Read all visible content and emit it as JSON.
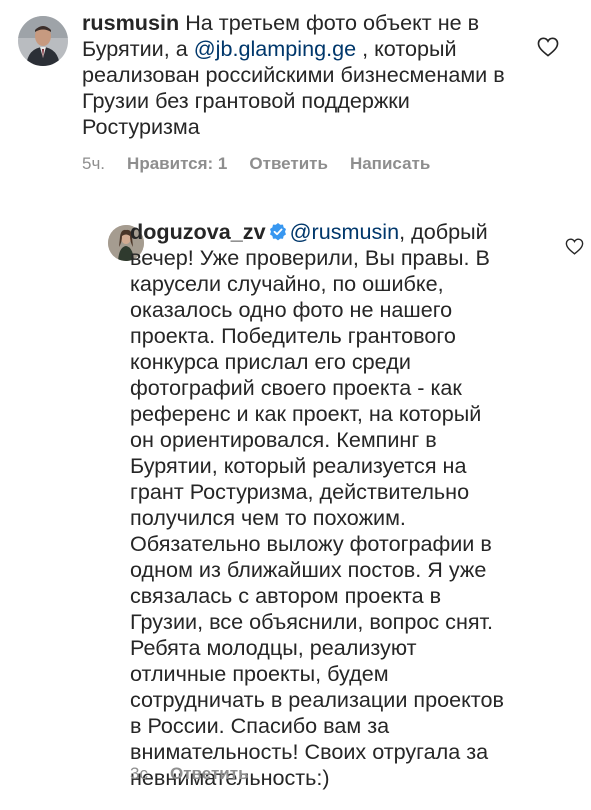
{
  "comments": [
    {
      "username": "rusmusin",
      "text_before": " На третьем фото объект не в Бурятии, а ",
      "mention": "@jb.glamping.ge",
      "text_after": " , который реализован российскими бизнесменами в Грузии без грантовой поддержки Ростуризма",
      "time": "5ч.",
      "likes_label": "Нравится: 1",
      "reply_label": "Ответить",
      "message_label": "Написать",
      "verified": false
    },
    {
      "username": "doguzova_zv",
      "mention": "@rusmusin",
      "text_after": ", добрый вечер! Уже проверили, Вы правы. В карусели случайно, по ошибке, оказалось одно фото не нашего проекта. Победитель грантового конкурса прислал его среди фотографий своего проекта - как референс и как проект, на который он ориентировался. Кемпинг в Бурятии, который реализуется на грант Ростуризма, действительно получился чем то похожим. Обязательно выложу фотографии в одном из ближайших постов. Я уже связалась с автором проекта в Грузии, все объяснили, вопрос снят. Ребята молодцы, реализуют отличные проекты, будем сотрудничать в реализации проектов в России. Спасибо вам за внимательность! Своих отругала за невнимательность:)",
      "time": "3с",
      "reply_label": "Ответить",
      "verified": true
    }
  ],
  "icons": {
    "like": "heart-outline-icon",
    "verified": "verified-badge-icon"
  },
  "colors": {
    "text": "#262626",
    "meta": "#8e8e8e",
    "mention": "#00376b",
    "verified": "#3897f0"
  }
}
